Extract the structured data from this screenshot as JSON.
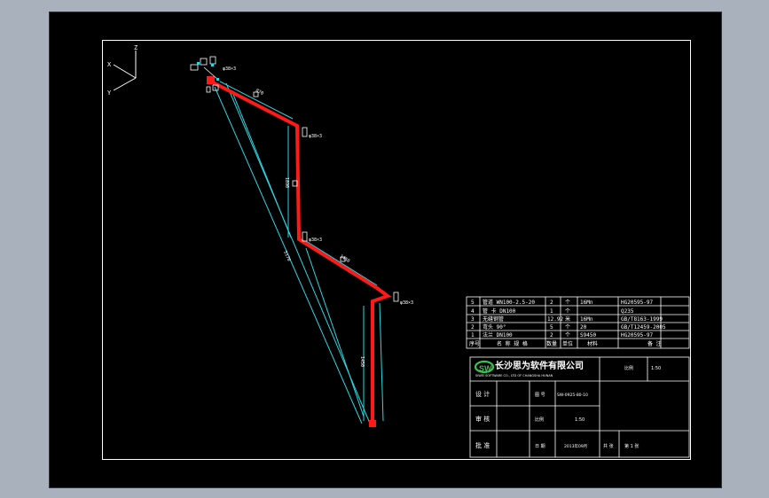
{
  "colors": {
    "background": "#a9b2bc",
    "sheet": "#000000",
    "pipe": "#ff1a1a",
    "dimension": "#29d8e6",
    "lines": "#ffffff",
    "logo": "#3fbf4f"
  },
  "axes": {
    "z": "Z",
    "x": "X",
    "y": "Y"
  },
  "pipe_labels": {
    "top": "φ38×3",
    "upper_elbow": "φ38×3",
    "middle_elbow": "φ38×3",
    "lower_elbow": "φ38×3"
  },
  "dimension_labels": {
    "seg1": "870",
    "vertical": "1890",
    "long_diag": "5170",
    "seg3": "1450",
    "lower_vertical": "1450"
  },
  "bom": {
    "rows": [
      {
        "no": "5",
        "name": "管道 WN100-2.5-20",
        "qty": "2",
        "unit": "个",
        "material": "16Mn",
        "standard": "HG20595-97"
      },
      {
        "no": "4",
        "name": "管 卡 DN100",
        "qty": "1",
        "unit": "个",
        "material": "",
        "standard": "Q235"
      },
      {
        "no": "3",
        "name": "无缝钢管",
        "qty": "12.92",
        "unit": "米",
        "material": "16Mn",
        "standard": "GB/T8163-1999"
      },
      {
        "no": "2",
        "name": "弯头 90°",
        "qty": "5",
        "unit": "个",
        "material": "20",
        "standard": "GB/T12459-2005"
      },
      {
        "no": "1",
        "name": "法兰 DN100",
        "qty": "2",
        "unit": "个",
        "material": "S9450",
        "standard": "HG20595-97"
      }
    ],
    "header": {
      "no": "序号",
      "name": "名 称 规 格",
      "qty": "数量",
      "unit": "单位",
      "material": "材料",
      "standard": "备 注"
    }
  },
  "title_block": {
    "company": "长沙思为软件有限公司",
    "company_en": "SIWEI SOFTWARE CO., LTD OF CHANGSHA HUNAN",
    "scale_label": "比例",
    "scale_value": "1:50",
    "design_label": "设   计",
    "check_label": "审   核",
    "approve_label": "批   准",
    "drawing_no_label": "图 号",
    "drawing_no": "SW-0925-80-10",
    "date_label": "日 期",
    "date": "2013年09月",
    "sheet_label": "共 张",
    "sheet_value": "第 1 张"
  }
}
